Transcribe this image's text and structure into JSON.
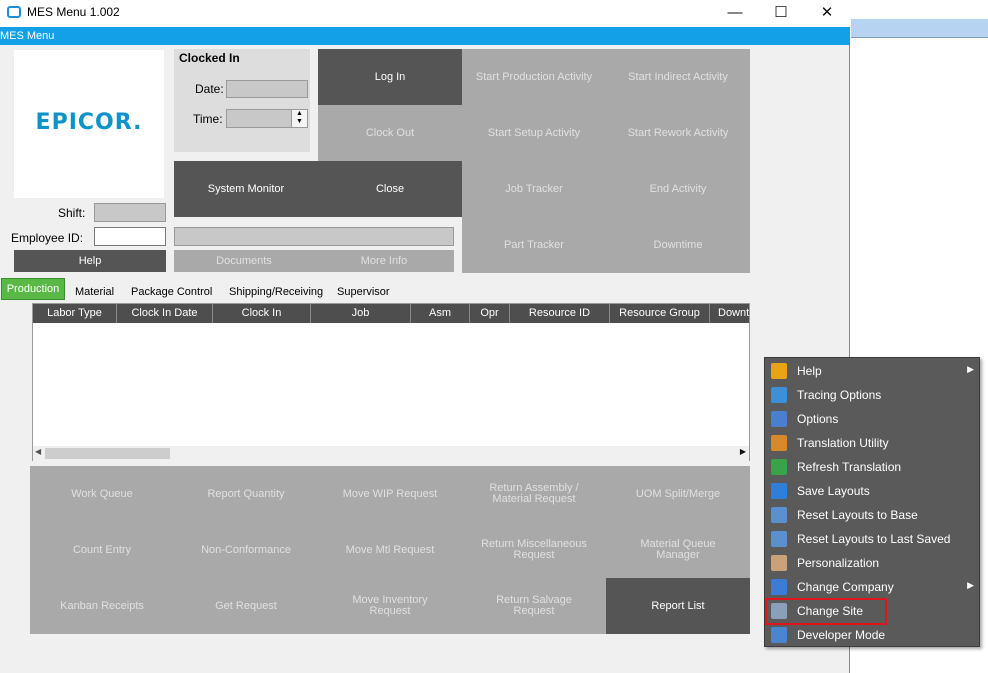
{
  "window": {
    "title": "MES Menu 1.002",
    "menu_label": "MES Menu",
    "controls": {
      "minimize": "—",
      "maximize": "☐",
      "close": "✕"
    }
  },
  "logo": {
    "text": "EPICOR."
  },
  "clock": {
    "heading": "Clocked In",
    "date_label": "Date:",
    "date_value": "",
    "time_label": "Time:",
    "time_value": ""
  },
  "top_buttons": {
    "log_in": "Log In",
    "clock_out": "Clock Out",
    "start_production": "Start Production Activity",
    "start_indirect": "Start Indirect Activity",
    "start_setup": "Start Setup Activity",
    "start_rework": "Start Rework Activity",
    "system_monitor": "System Monitor",
    "close": "Close",
    "job_tracker": "Job Tracker",
    "end_activity": "End Activity",
    "part_tracker": "Part Tracker",
    "downtime": "Downtime",
    "help": "Help",
    "documents": "Documents",
    "more_info": "More Info"
  },
  "employee": {
    "shift_label": "Shift:",
    "shift_value": "",
    "employee_id_label": "Employee ID:",
    "employee_id_value": ""
  },
  "tabs": [
    "Production",
    "Material",
    "Package Control",
    "Shipping/Receiving",
    "Supervisor"
  ],
  "grid": {
    "columns": [
      "Labor Type",
      "Clock In Date",
      "Clock In",
      "Job",
      "Asm",
      "Opr",
      "Resource ID",
      "Resource Group",
      "Downt"
    ]
  },
  "action_buttons": [
    {
      "label": "Work Queue",
      "style": "gray"
    },
    {
      "label": "Report Quantity",
      "style": "gray"
    },
    {
      "label": "Move WIP Request",
      "style": "gray"
    },
    {
      "label": "Return Assembly / Material Request",
      "style": "gray"
    },
    {
      "label": "UOM Split/Merge",
      "style": "gray"
    },
    {
      "label": "Count Entry",
      "style": "gray"
    },
    {
      "label": "Non-Conformance",
      "style": "gray"
    },
    {
      "label": "Move Mtl Request",
      "style": "gray"
    },
    {
      "label": "Return Miscellaneous Request",
      "style": "gray"
    },
    {
      "label": "Material Queue Manager",
      "style": "gray"
    },
    {
      "label": "Kanban Receipts",
      "style": "gray"
    },
    {
      "label": "Get Request",
      "style": "gray"
    },
    {
      "label": "Move Inventory Request",
      "style": "gray"
    },
    {
      "label": "Return Salvage Request",
      "style": "gray"
    },
    {
      "label": "Report List",
      "style": "dark"
    }
  ],
  "context_menu": {
    "items": [
      {
        "label": "Help",
        "icon": "help-icon",
        "has_submenu": true,
        "color": "#e8a317"
      },
      {
        "label": "Tracing Options",
        "icon": "tracing-icon",
        "has_submenu": false,
        "color": "#3d8fd8"
      },
      {
        "label": "Options",
        "icon": "options-icon",
        "has_submenu": false,
        "color": "#4a7fd0"
      },
      {
        "label": "Translation Utility",
        "icon": "translation-icon",
        "has_submenu": false,
        "color": "#d88a2a"
      },
      {
        "label": "Refresh Translation",
        "icon": "refresh-icon",
        "has_submenu": false,
        "color": "#3aa34a"
      },
      {
        "label": "Save Layouts",
        "icon": "save-icon",
        "has_submenu": false,
        "color": "#2f7ed8"
      },
      {
        "label": "Reset Layouts to Base",
        "icon": "reset-base-icon",
        "has_submenu": false,
        "color": "#5a8fd0"
      },
      {
        "label": "Reset Layouts to Last Saved",
        "icon": "reset-saved-icon",
        "has_submenu": false,
        "color": "#5a8fd0"
      },
      {
        "label": "Personalization",
        "icon": "person-icon",
        "has_submenu": false,
        "color": "#c9a27a"
      },
      {
        "label": "Change Company",
        "icon": "company-icon",
        "has_submenu": true,
        "color": "#3c7bd6"
      },
      {
        "label": "Change Site",
        "icon": "site-icon",
        "has_submenu": false,
        "color": "#8aa0b8"
      },
      {
        "label": "Developer Mode",
        "icon": "developer-icon",
        "has_submenu": false,
        "color": "#4a86d0"
      }
    ],
    "highlighted": "Change Site",
    "highlight_color": "#e0141c"
  },
  "colors": {
    "accent": "#14a0e6",
    "active_tab": "#5ab846",
    "dark_button": "#555555",
    "disabled_button": "#a9a9a9",
    "menu_bg": "#5a5a5a"
  }
}
